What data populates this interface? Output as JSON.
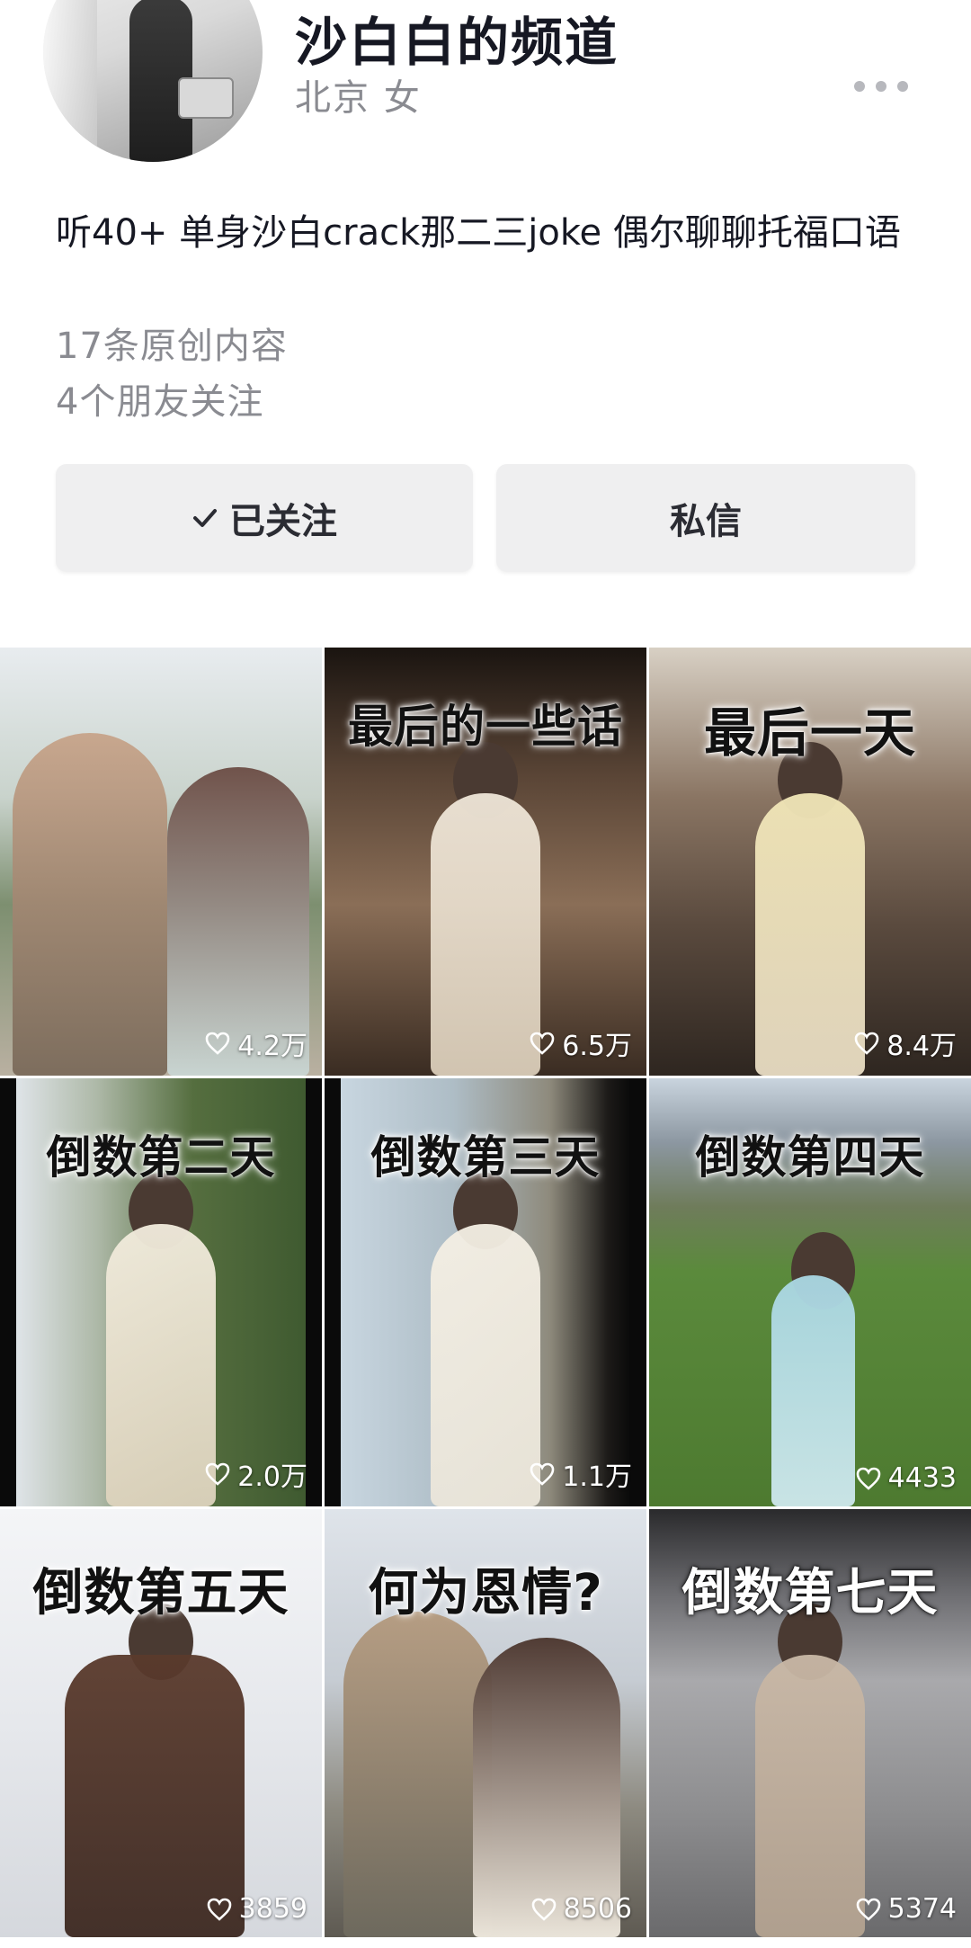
{
  "profile": {
    "name_partial": "沙白白 的 频 道",
    "name": "沙白白的频道",
    "location": "北京  女",
    "bio": "听40+ 单身沙白crack那二三joke 偶尔聊聊托福口语",
    "original_count": "17条原创内容",
    "friends_follow": "4个朋友关注"
  },
  "actions": {
    "follow_label": "已关注",
    "message_label": "私信"
  },
  "colors": {
    "accent_bg": "#efeff0",
    "text_primary": "#161823",
    "text_secondary": "#8a8b91"
  },
  "videos": [
    {
      "title": "",
      "likes": "4.2万",
      "tone": "outdoor-green"
    },
    {
      "title": "最后的一些话",
      "likes": "6.5万",
      "tone": "hotel-warm"
    },
    {
      "title": "最后一天",
      "likes": "8.4万",
      "tone": "hotel-warm"
    },
    {
      "title": "倒数第二天",
      "likes": "2.0万",
      "tone": "garden"
    },
    {
      "title": "倒数第三天",
      "likes": "1.1万",
      "tone": "lake"
    },
    {
      "title": "倒数第四天",
      "likes": "4433",
      "tone": "field"
    },
    {
      "title": "倒数第五天",
      "likes": "3859",
      "tone": "snow"
    },
    {
      "title": "何为恩情?",
      "likes": "8506",
      "tone": "outdoor-sky"
    },
    {
      "title": "倒数第七天",
      "likes": "5374",
      "tone": "street"
    }
  ]
}
